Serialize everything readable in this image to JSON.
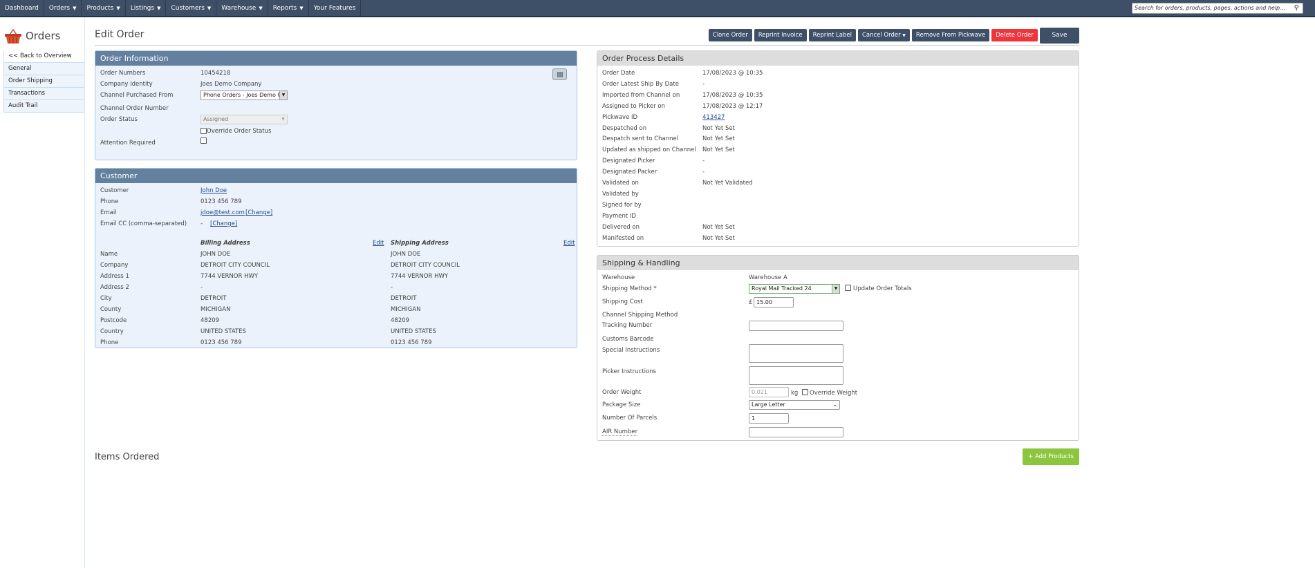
{
  "nav": {
    "items": [
      {
        "label": "Dashboard",
        "caret": false
      },
      {
        "label": "Orders",
        "caret": true
      },
      {
        "label": "Products",
        "caret": true
      },
      {
        "label": "Listings",
        "caret": true
      },
      {
        "label": "Customers",
        "caret": true
      },
      {
        "label": "Warehouse",
        "caret": true
      },
      {
        "label": "Reports",
        "caret": true
      },
      {
        "label": "Your Features",
        "caret": false
      }
    ],
    "search_placeholder": "Search for orders, products, pages, actions and help..."
  },
  "sidebar": {
    "title": "Orders",
    "items": [
      "<< Back to Overview",
      "General",
      "Order Shipping",
      "Transactions",
      "Audit Trail"
    ]
  },
  "page": {
    "title": "Edit Order",
    "buttons": {
      "clone": "Clone Order",
      "invoice": "Reprint Invoice",
      "label": "Reprint Label",
      "cancel": "Cancel Order",
      "pickwave": "Remove From Pickwave",
      "delete": "Delete Order",
      "save": "Save"
    }
  },
  "order_info": {
    "title": "Order Information",
    "labels": [
      "Order Numbers",
      "Company Identity",
      "Channel Purchased From",
      "Channel Order Number",
      "Order Status",
      "Attention Required"
    ],
    "order_number": "10454218",
    "company": "Joes Demo Company",
    "channel": "Phone Orders - Joes Demo Cc",
    "status": "Assigned",
    "override_label": "Override Order Status"
  },
  "customer": {
    "title": "Customer",
    "labels": [
      "Customer",
      "Phone",
      "Email",
      "Email CC (comma-separated)"
    ],
    "name": "John Doe",
    "phone": "0123 456 789",
    "email": "jdoe@test.com",
    "change": "[Change]",
    "email_cc": "-",
    "billing_heading": "Billing Address",
    "shipping_heading": "Shipping Address",
    "edit": "Edit",
    "addr_labels": [
      "Name",
      "Company",
      "Address 1",
      "Address 2",
      "City",
      "County",
      "Postcode",
      "Country",
      "Phone"
    ],
    "billing": [
      "JOHN DOE",
      "DETROIT CITY COUNCIL",
      "7744 VERNOR HWY",
      "-",
      "DETROIT",
      "MICHIGAN",
      "48209",
      "UNITED STATES",
      "0123 456 789"
    ],
    "shipping": [
      "JOHN DOE",
      "DETROIT CITY COUNCIL",
      "7744 VERNOR HWY",
      "-",
      "DETROIT",
      "MICHIGAN",
      "48209",
      "UNITED STATES",
      "0123 456 789"
    ]
  },
  "process": {
    "title": "Order Process Details",
    "rows": [
      {
        "label": "Order Date",
        "value": "17/08/2023 @ 10:35"
      },
      {
        "label": "Order Latest Ship By Date",
        "value": "-"
      },
      {
        "label": "Imported from Channel on",
        "value": "17/08/2023 @ 10:35"
      },
      {
        "label": "Assigned to Picker on",
        "value": "17/08/2023 @ 12:17"
      },
      {
        "label": "Pickwave ID",
        "value": "413427"
      },
      {
        "label": "Despatched on",
        "value": "Not Yet Set"
      },
      {
        "label": "Despatch sent to Channel",
        "value": "Not Yet Set"
      },
      {
        "label": "Updated as shipped on Channel",
        "value": "Not Yet Set"
      },
      {
        "label": "Designated Picker",
        "value": "-"
      },
      {
        "label": "Designated Packer",
        "value": "-"
      },
      {
        "label": "Validated on",
        "value": "Not Yet Validated"
      },
      {
        "label": "Validated by",
        "value": ""
      },
      {
        "label": "Signed for by",
        "value": ""
      },
      {
        "label": "Payment ID",
        "value": ""
      },
      {
        "label": "Delivered on",
        "value": "Not Yet Set"
      },
      {
        "label": "Manifested on",
        "value": "Not Yet Set"
      }
    ]
  },
  "shipping": {
    "title": "Shipping & Handling",
    "labels": {
      "warehouse": "Warehouse",
      "method": "Shipping Method *",
      "cost": "Shipping Cost",
      "channel_method": "Channel Shipping Method",
      "tracking": "Tracking Number",
      "customs": "Customs Barcode",
      "special": "Special Instructions",
      "picker": "Picker Instructions",
      "weight": "Order Weight",
      "package": "Package Size",
      "parcels": "Number Of Parcels",
      "air": "AIR Number"
    },
    "warehouse": "Warehouse A",
    "method": "Royal Mail Tracked 24",
    "update_totals": "Update Order Totals",
    "currency": "£",
    "cost": "15.00",
    "weight": "0.021",
    "weight_unit": "kg",
    "override_weight": "Override Weight",
    "package": "Large Letter",
    "parcels": "1"
  },
  "items": {
    "title": "Items Ordered",
    "add": "+ Add Products"
  }
}
